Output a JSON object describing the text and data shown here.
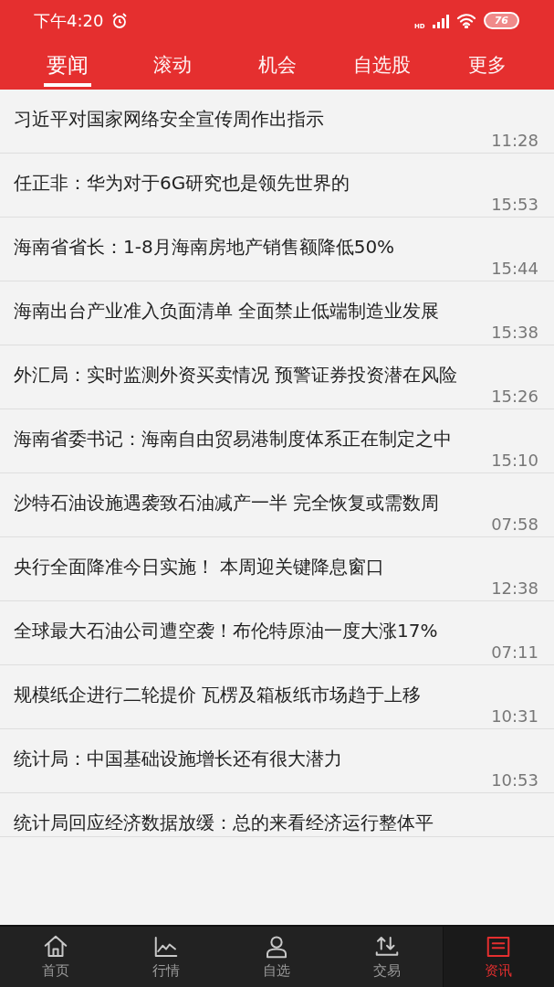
{
  "status_bar": {
    "time": "下午4:20",
    "network": "HD",
    "battery": "76"
  },
  "tabs": [
    {
      "label": "要闻",
      "selected": true
    },
    {
      "label": "滚动",
      "selected": false
    },
    {
      "label": "机会",
      "selected": false
    },
    {
      "label": "自选股",
      "selected": false
    },
    {
      "label": "更多",
      "selected": false
    }
  ],
  "news": [
    {
      "title": "习近平对国家网络安全宣传周作出指示",
      "time": "11:28"
    },
    {
      "title": "任正非：华为对于6G研究也是领先世界的",
      "time": "15:53"
    },
    {
      "title": "海南省省长：1-8月海南房地产销售额降低50%",
      "time": "15:44"
    },
    {
      "title": "海南出台产业准入负面清单 全面禁止低端制造业发展",
      "time": "15:38"
    },
    {
      "title": "外汇局：实时监测外资买卖情况 预警证券投资潜在风险",
      "time": "15:26"
    },
    {
      "title": "海南省委书记：海南自由贸易港制度体系正在制定之中",
      "time": "15:10"
    },
    {
      "title": "沙特石油设施遇袭致石油减产一半 完全恢复或需数周",
      "time": "07:58"
    },
    {
      "title": "央行全面降准今日实施！ 本周迎关键降息窗口",
      "time": "12:38"
    },
    {
      "title": "全球最大石油公司遭空袭！布伦特原油一度大涨17%",
      "time": "07:11"
    },
    {
      "title": "规模纸企进行二轮提价 瓦楞及箱板纸市场趋于上移",
      "time": "10:31"
    },
    {
      "title": "统计局：中国基础设施增长还有很大潜力",
      "time": "10:53"
    },
    {
      "title": "统计局回应经济数据放缓：总的来看经济运行整体平"
    }
  ],
  "bottom_nav": [
    {
      "label": "首页",
      "kind": "home",
      "selected": false
    },
    {
      "label": "行情",
      "kind": "chart",
      "selected": false
    },
    {
      "label": "自选",
      "kind": "user",
      "selected": false
    },
    {
      "label": "交易",
      "kind": "trade",
      "selected": false
    },
    {
      "label": "资讯",
      "kind": "news",
      "selected": true
    }
  ]
}
